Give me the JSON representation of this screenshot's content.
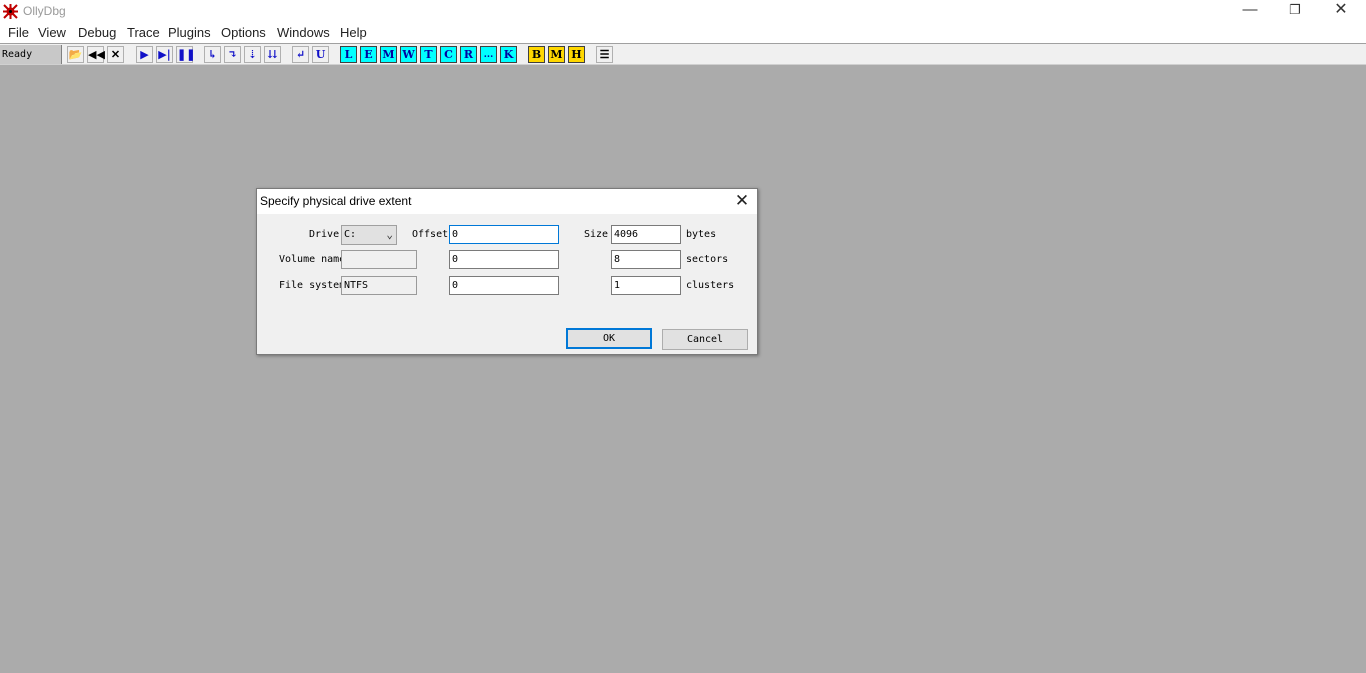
{
  "window": {
    "title": "OllyDbg",
    "min_glyph": "—",
    "max_glyph": "❐",
    "close_glyph": "✕"
  },
  "menu": [
    "File",
    "View",
    "Debug",
    "Trace",
    "Plugins",
    "Options",
    "Windows",
    "Help"
  ],
  "toolbar": {
    "status": "Ready",
    "buttons": [
      {
        "label": "📂",
        "icon": "open-icon"
      },
      {
        "label": "◀◀",
        "icon": "restart-icon"
      },
      {
        "label": "✕",
        "icon": "close-program-icon"
      },
      {
        "label": "▶",
        "icon": "run-icon"
      },
      {
        "label": "▶|",
        "icon": "run-thread-icon"
      },
      {
        "label": "❚❚",
        "icon": "pause-icon"
      },
      {
        "label": "↳",
        "icon": "step-into-icon"
      },
      {
        "label": "↴",
        "icon": "step-over-icon"
      },
      {
        "label": "⇣",
        "icon": "animate-into-icon"
      },
      {
        "label": "⇊",
        "icon": "animate-over-icon"
      },
      {
        "label": "↵",
        "icon": "execute-till-return-icon"
      },
      {
        "label": "U",
        "icon": "execute-till-user-code-icon"
      },
      {
        "label": "L",
        "icon": "log-window-icon"
      },
      {
        "label": "E",
        "icon": "modules-window-icon"
      },
      {
        "label": "M",
        "icon": "memory-window-icon"
      },
      {
        "label": "W",
        "icon": "windows-window-icon"
      },
      {
        "label": "T",
        "icon": "threads-window-icon"
      },
      {
        "label": "C",
        "icon": "cpu-window-icon"
      },
      {
        "label": "R",
        "icon": "references-window-icon"
      },
      {
        "label": "...",
        "icon": "run-trace-icon"
      },
      {
        "label": "K",
        "icon": "call-stack-icon"
      },
      {
        "label": "B",
        "icon": "breakpoints-icon"
      },
      {
        "label": "M",
        "icon": "memory-breakpoints-icon"
      },
      {
        "label": "H",
        "icon": "hardware-breakpoints-icon"
      },
      {
        "label": "☰",
        "icon": "list-icon"
      }
    ]
  },
  "dialog": {
    "title": "Specify physical drive extent",
    "close_glyph": "✕",
    "labels": {
      "drive": "Drive",
      "volume_name": "Volume name",
      "file_system": "File system",
      "offset": "Offset",
      "size": "Size",
      "bytes": "bytes",
      "sectors": "sectors",
      "clusters": "clusters"
    },
    "drive_value": "C:",
    "volume_name_value": "",
    "file_system_value": "NTFS",
    "offset_values": [
      "0",
      "0",
      "0"
    ],
    "size_values": [
      "4096",
      "8",
      "1"
    ],
    "ok_label": "OK",
    "cancel_label": "Cancel"
  },
  "colors": {
    "workspace": "#ababab",
    "cyan_button": "#00ffff",
    "yellow_button": "#ffd700",
    "focus_border": "#0078d7"
  }
}
